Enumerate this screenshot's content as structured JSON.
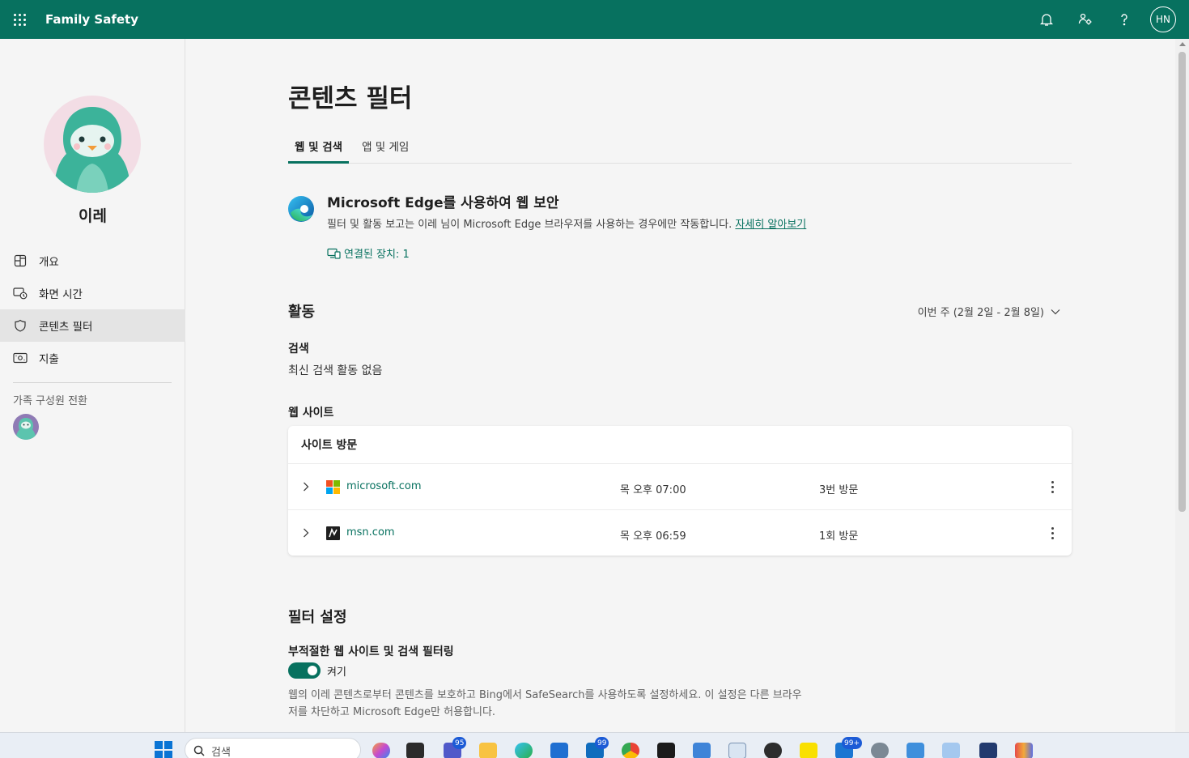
{
  "header": {
    "app_title": "Family Safety",
    "avatar_initials": "HN",
    "icons": [
      "waffle-icon",
      "bell-icon",
      "people-settings-icon",
      "help-icon"
    ],
    "brand_color": "#07715f"
  },
  "sidebar": {
    "profile_name": "이레",
    "items": [
      {
        "label": "개요",
        "icon": "overview-icon"
      },
      {
        "label": "화면 시간",
        "icon": "screen-time-icon"
      },
      {
        "label": "콘텐츠 필터",
        "icon": "shield-icon",
        "active": true
      },
      {
        "label": "지출",
        "icon": "money-icon"
      }
    ],
    "switch_label": "가족 구성원 전환"
  },
  "main": {
    "page_title": "콘텐츠 필터",
    "tabs": [
      {
        "label": "웹 및 검색",
        "active": true
      },
      {
        "label": "앱 및 게임",
        "active": false
      }
    ],
    "edge": {
      "title": "Microsoft Edge를 사용하여 웹 보안",
      "description": "필터 및 활동 보고는 이레 님이 Microsoft Edge 브라우저를 사용하는 경우에만 작동합니다.",
      "learn_more": "자세히 알아보기",
      "devices": "연결된 장치: 1"
    },
    "activity": {
      "heading": "활동",
      "week": "이번 주 (2월 2일 - 2월 8일)",
      "search_heading": "검색",
      "search_empty": "최신 검색 활동 없음",
      "web_heading": "웹 사이트",
      "card_header": "사이트 방문",
      "sites": [
        {
          "domain": "microsoft.com",
          "time": "목 오후 07:00",
          "visits": "3번 방문",
          "favicon": "microsoft-logo-icon"
        },
        {
          "domain": "msn.com",
          "time": "목 오후 06:59",
          "visits": "1회 방문",
          "favicon": "msn-logo-icon"
        }
      ]
    },
    "filter": {
      "heading": "필터 설정",
      "subheading": "부적절한 웹 사이트 및 검색 필터링",
      "toggle_label": "켜기",
      "toggle_on": true,
      "description": "웹의 이레 콘텐츠로부터 콘텐츠를 보호하고 Bing에서 SafeSearch를 사용하도록 설정하세요. 이 설정은 다른 브라우저를 차단하고 Microsoft Edge만 허용합니다."
    }
  },
  "taskbar": {
    "search_placeholder": "검색",
    "badges": {
      "teams": "95",
      "outlook": "99",
      "notes": "99+"
    }
  }
}
